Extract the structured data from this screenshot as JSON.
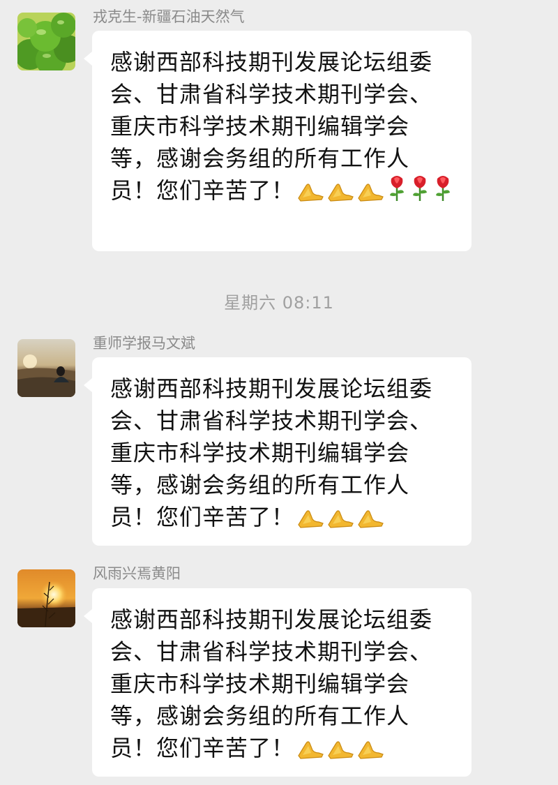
{
  "timestamp": "星期六 08:11",
  "messages": [
    {
      "sender": "戎克生-新疆石油天然气",
      "text": "感谢西部科技期刊发展论坛组委会、甘肃省科学技术期刊学会、重庆市科学技术期刊编辑学会等，感谢会务组的所有工作人员！您们辛苦了！",
      "emojis": [
        "folded-hands",
        "folded-hands",
        "folded-hands",
        "rose",
        "rose",
        "rose"
      ]
    },
    {
      "sender": "重师学报马文斌",
      "text": "感谢西部科技期刊发展论坛组委会、甘肃省科学技术期刊学会、重庆市科学技术期刊编辑学会等，感谢会务组的所有工作人员！您们辛苦了！",
      "emojis": [
        "folded-hands",
        "folded-hands",
        "folded-hands"
      ]
    },
    {
      "sender": "风雨兴焉黄阳",
      "text": "感谢西部科技期刊发展论坛组委会、甘肃省科学技术期刊学会、重庆市科学技术期刊编辑学会等，感谢会务组的所有工作人员！您们辛苦了！",
      "emojis": [
        "folded-hands",
        "folded-hands",
        "folded-hands"
      ]
    }
  ],
  "colors": {
    "background": "#ededed",
    "bubble": "#ffffff",
    "sender_text": "#8a8a8a",
    "timestamp_text": "#a0a0a0"
  }
}
